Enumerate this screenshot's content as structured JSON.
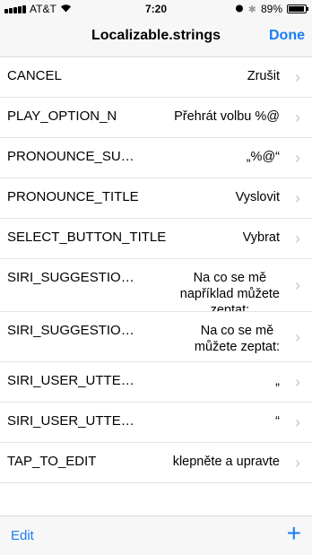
{
  "status_bar": {
    "carrier": "AT&T",
    "time": "7:20",
    "battery": "89%"
  },
  "nav": {
    "title": "Localizable.strings",
    "done_label": "Done"
  },
  "rows": [
    {
      "key": "CANCEL",
      "value": "Zrušit"
    },
    {
      "key": "PLAY_OPTION_N",
      "value": "Přehrát volbu %@"
    },
    {
      "key": "PRONOUNCE_SU…",
      "value": "„%@“"
    },
    {
      "key": "PRONOUNCE_TITLE",
      "value": "Vyslovit"
    },
    {
      "key": "SELECT_BUTTON_TITLE",
      "value": "Vybrat"
    },
    {
      "key": "SIRI_SUGGESTIO…",
      "value": "Na co se mě\nnapříklad můžete\nzeptat:"
    },
    {
      "key": "SIRI_SUGGESTIO…",
      "value": "Na co se mě\nmůžete zeptat:"
    },
    {
      "key": "SIRI_USER_UTTE…",
      "value": "„"
    },
    {
      "key": "SIRI_USER_UTTE…",
      "value": "“"
    },
    {
      "key": "TAP_TO_EDIT",
      "value": "klepněte a upravte"
    }
  ],
  "toolbar": {
    "edit_label": "Edit",
    "add_label": "+"
  }
}
